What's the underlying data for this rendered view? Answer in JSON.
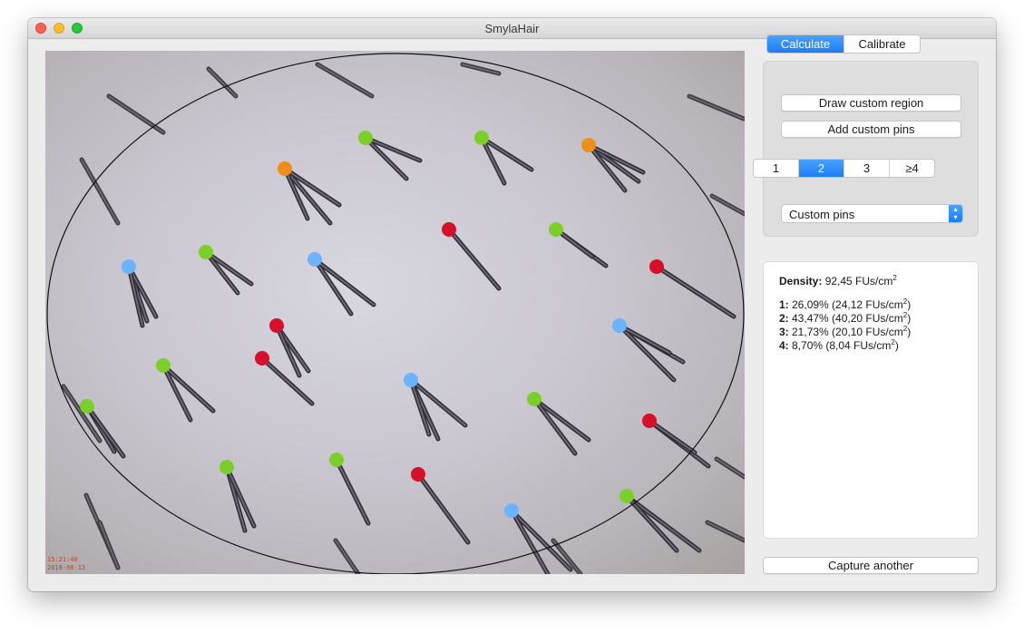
{
  "window": {
    "title": "SmylaHair"
  },
  "photo": {
    "timestamp_time": "15:21:40",
    "timestamp_date": "2018-08-13",
    "pin_colors": {
      "1": "#ef8f1b",
      "2": "#7ccf2a",
      "3": "#6cb3ff",
      "4": "#d6102a"
    }
  },
  "tabs": [
    {
      "label": "Calculate",
      "selected": true
    },
    {
      "label": "Calibrate",
      "selected": false
    }
  ],
  "actions": {
    "draw_region_label": "Draw custom region",
    "add_pins_label": "Add custom pins",
    "capture_label": "Capture another"
  },
  "count_selector": [
    {
      "label": "1",
      "selected": false
    },
    {
      "label": "2",
      "selected": true
    },
    {
      "label": "3",
      "selected": false
    },
    {
      "label": "≥4",
      "selected": false
    }
  ],
  "pin_mode": {
    "selected": "Custom pins"
  },
  "results": {
    "density_label": "Density:",
    "density_value": "92,45 FUs/cm",
    "density_exp": "2",
    "rows": [
      {
        "key": "1:",
        "value": "26,09% (24,12 FUs/cm",
        "exp": "2",
        "tail": ")"
      },
      {
        "key": "2:",
        "value": "43,47% (40,20 FUs/cm",
        "exp": "2",
        "tail": ")"
      },
      {
        "key": "3:",
        "value": "21,73% (20,10 FUs/cm",
        "exp": "2",
        "tail": ")"
      },
      {
        "key": "4:",
        "value": "8,70% (8,04 FUs/cm",
        "exp": "2",
        "tail": ")"
      }
    ]
  }
}
